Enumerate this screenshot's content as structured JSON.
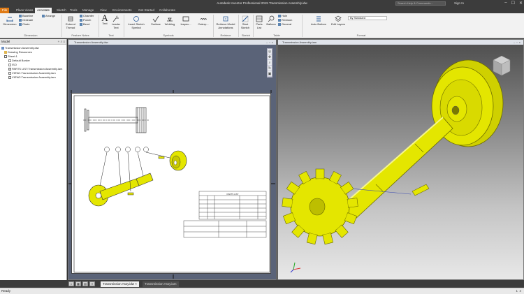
{
  "window": {
    "title": "Autodesk Inventor Professional 2019   Transmission Assembly.idw",
    "search_placeholder": "Search Help & Commands...",
    "sign_in": "Sign In",
    "controls": [
      "–",
      "☐",
      "✕"
    ]
  },
  "ribbon_tabs": [
    "File",
    "Place Views",
    "Annotate",
    "Sketch",
    "Tools",
    "Manage",
    "View",
    "Environments",
    "Get Started",
    "Collaborate"
  ],
  "ribbon": {
    "dimension": {
      "label": "Dimension",
      "baseline": "Baseline",
      "arrange": "Arrange",
      "ordinate": "Ordinate",
      "chain": "Chain"
    },
    "feature_notes": {
      "entered_thread": "Entered Thread",
      "chamfer": "Chamfer",
      "punch": "Punch",
      "bend": "Bend",
      "hole": "Hole"
    },
    "text": {
      "text": "Text",
      "leader_text": "Leader Text"
    },
    "symbols": {
      "insert_sketch_symbol": "Insert Sketch Symbol",
      "surface": "Surface",
      "welding": "Welding",
      "inspection": "Inspec...",
      "caterpillar": "Caterp..."
    },
    "table": {
      "balloon": "Balloon",
      "parts_list": "Parts List",
      "hole": "Hole",
      "revision": "Revision",
      "general": "General",
      "start_sketch": "Start Sketch",
      "retrieve_model_annotations": "Retrieve Model Annotations"
    },
    "format": {
      "auto_bottom": "Auto Bottom",
      "edit_layers": "Edit Layers",
      "style": "By Standard"
    },
    "groups": [
      "Dimension",
      "Feature Notes",
      "Text",
      "Symbols",
      "Retrieve",
      "Sketch",
      "Table",
      "Format"
    ]
  },
  "browser": {
    "title": "Model",
    "tree": [
      "Transmission Assembly.idw",
      "Drawing Resources",
      "Sheet:1",
      "Default Border",
      "ISO",
      "PARTS LIST:Transmission Assembly.iam",
      "VIEW1:Transmission Assembly.iam",
      "VIEW2:Transmission Assembly.iam"
    ]
  },
  "drawing_window": {
    "title": "Transmission Assembly.idw",
    "parts_list_title": "PARTS LIST",
    "parts_list_headers": [
      "ITEM",
      "QTY",
      "PART NUMBER",
      "DESCRIPTION",
      "MASS"
    ]
  },
  "model_window": {
    "title": "Transmission Assembly.iam"
  },
  "doc_tabs": [
    "Transmission Assy.idw",
    "Transmission Assy.iam"
  ],
  "status": {
    "text": "Ready",
    "counts": [
      "1",
      "4"
    ]
  },
  "colors": {
    "part_yellow": "#e4e600",
    "accent_orange": "#e07a14",
    "titlebar": "#3c3c3c"
  }
}
